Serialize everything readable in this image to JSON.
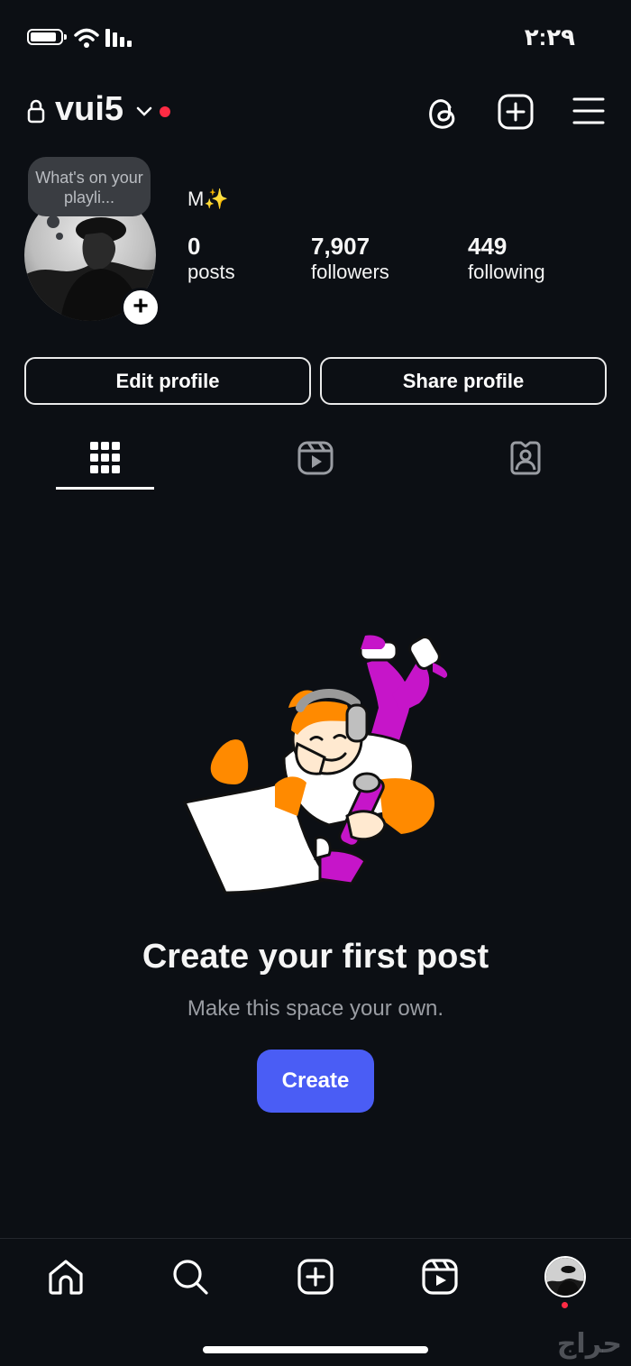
{
  "status_bar": {
    "time": "٢:٢٩"
  },
  "header": {
    "username": "vui5"
  },
  "profile": {
    "note": "What's on your playli...",
    "display_name": "M✨",
    "stats": [
      {
        "value": "0",
        "label": "posts"
      },
      {
        "value": "7,907",
        "label": "followers"
      },
      {
        "value": "449",
        "label": "following"
      }
    ]
  },
  "buttons": {
    "edit": "Edit profile",
    "share": "Share profile"
  },
  "empty_state": {
    "title": "Create your first post",
    "subtitle": "Make this space your own.",
    "cta": "Create"
  },
  "watermark": "حراج",
  "colors": {
    "background": "#0c0f14",
    "accent": "#4a5df5",
    "notification": "#ff2b44"
  }
}
